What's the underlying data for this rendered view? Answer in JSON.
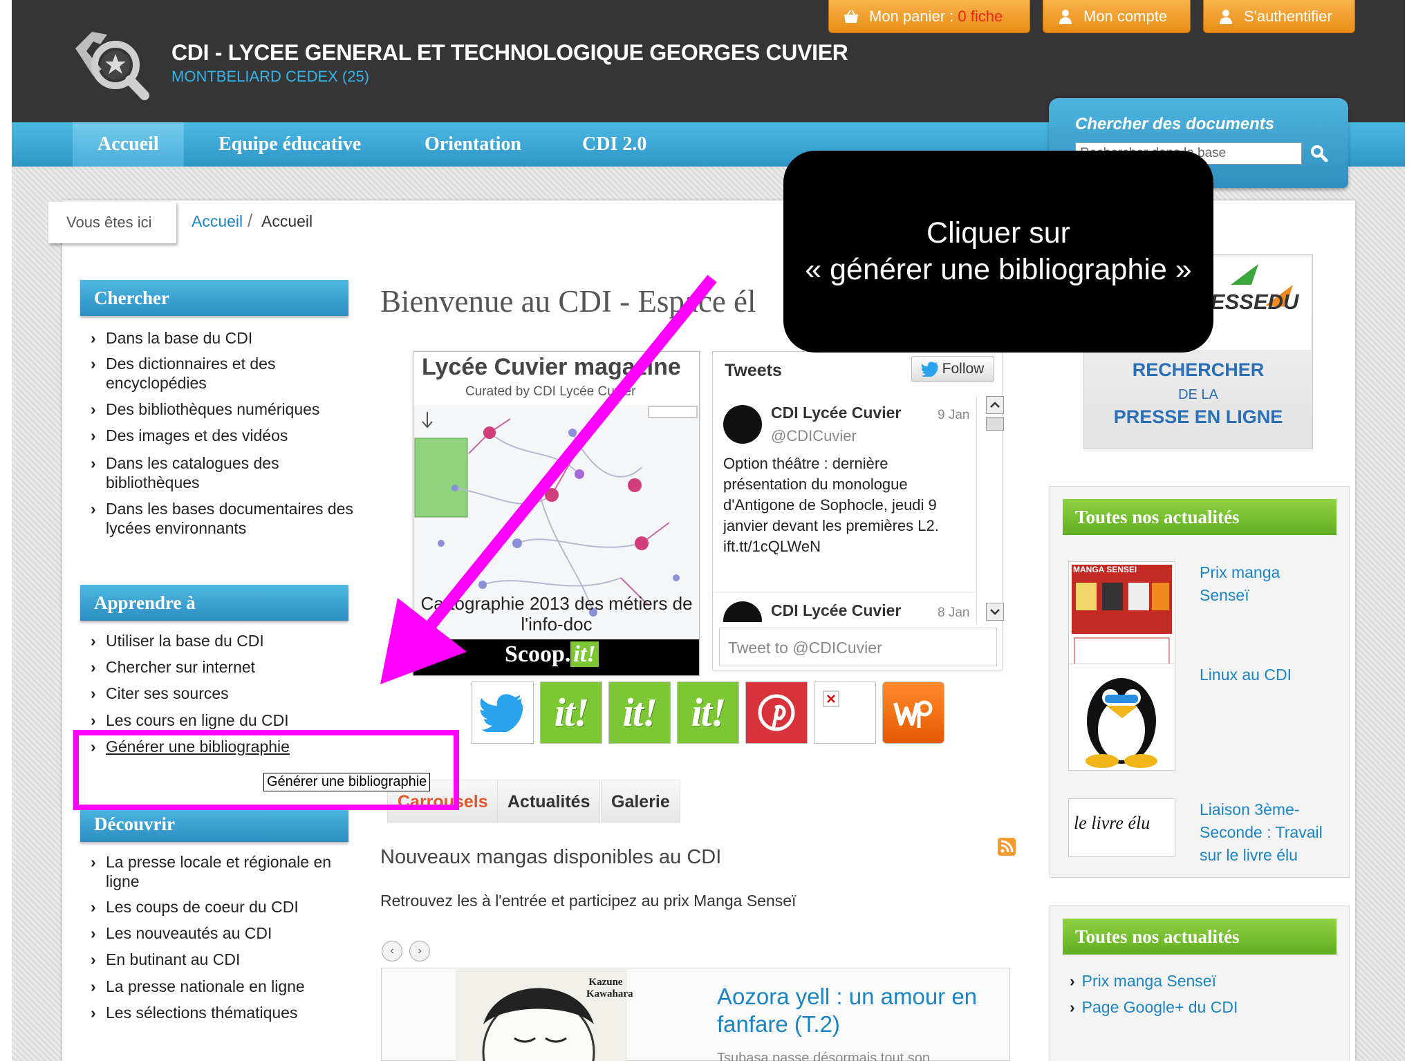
{
  "header": {
    "title": "CDI - LYCEE GENERAL ET TECHNOLOGIQUE GEORGES CUVIER",
    "subtitle": "MONTBELIARD CEDEX (25)",
    "basket_label": "Mon panier : ",
    "basket_count": "0 fiche",
    "account_label": "Mon compte",
    "login_label": "S'authentifier"
  },
  "nav": {
    "items": [
      "Accueil",
      "Equipe éducative",
      "Orientation",
      "CDI 2.0"
    ]
  },
  "search": {
    "title": "Chercher des documents",
    "placeholder": "Rechercher dans la base"
  },
  "breadcrumb": {
    "label": "Vous êtes ici",
    "link": "Accueil",
    "separator": "/",
    "current": "Accueil"
  },
  "sidebar": {
    "chercher": {
      "title": "Chercher",
      "items": [
        "Dans la base du CDI",
        "Des dictionnaires et des encyclopédies",
        "Des bibliothèques numériques",
        "Des images et des vidéos",
        "Dans les catalogues des bibliothèques",
        "Dans les bases documentaires des lycées environnants"
      ]
    },
    "apprendre": {
      "title": "Apprendre à",
      "items": [
        "Utiliser la base du CDI",
        "Chercher sur internet",
        "Citer ses sources",
        "Les cours en ligne du CDI",
        "Générer une bibliographie"
      ]
    },
    "decouvrir": {
      "title": "Découvrir",
      "items": [
        "La presse locale et régionale en ligne",
        "Les coups de coeur du CDI",
        "Les nouveautés au CDI",
        "En butinant au CDI",
        "La presse nationale en ligne",
        "Les sélections thématiques"
      ]
    }
  },
  "tooltip": "Générer une bibliographie",
  "callout": {
    "line1": "Cliquer sur",
    "line2": "« générer une bibliographie »"
  },
  "main": {
    "welcome": "Bienvenue au CDI - Espace él",
    "magazine": {
      "title": "Lycée Cuvier magazine",
      "curated": "Curated by CDI Lycée Cuvier",
      "caption": "Cartographie 2013 des métiers de l'info-doc",
      "brand": "Scoop.",
      "brand_it": "it!"
    },
    "tweets": {
      "title": "Tweets",
      "follow": "Follow",
      "input_placeholder": "Tweet to @CDICuvier",
      "items": [
        {
          "name": "CDI Lycée Cuvier",
          "handle": "@CDICuvier",
          "date": "9 Jan",
          "text": "Option théâtre : dernière présentation du monologue d'Antigone de Sophocle, jeudi 9 janvier devant les premières L2. ift.tt/1cQLWeN"
        },
        {
          "name": "CDI Lycée Cuvier",
          "date": "8 Jan"
        }
      ]
    },
    "social_it": "it!",
    "tabs": [
      "Carrousels",
      "Actualités",
      "Galerie"
    ],
    "news_title": "Nouveaux mangas disponibles au CDI",
    "news_desc": "Retrouvez les à l'entrée et participez au prix Manga Senseï",
    "carousel": {
      "title": "Aozora yell : un amour en fanfare (T.2)",
      "sub": "Tsubasa passe désormais tout son",
      "cover_author": "Kazune Kawahara"
    }
  },
  "right": {
    "presse": {
      "line1": "RECHERCHER",
      "line2": "DE LA",
      "line3": "PRESSE EN LIGNE",
      "logo_text": "COM ESSEDU"
    },
    "news1": {
      "title": "Toutes nos actualités",
      "items": [
        "Prix manga Senseï",
        "Linux au CDI",
        "Liaison 3ème-Seconde : Travail sur le livre élu"
      ],
      "thumb_text_manga": "MANGA SENSEI",
      "thumb_text_livre": "le livre élu"
    },
    "news2": {
      "title": "Toutes nos actualités",
      "items": [
        "Prix manga Senseï",
        "Page Google+ du CDI"
      ]
    }
  },
  "colors": {
    "accent_blue": "#35b3e8",
    "orange": "#f0a030",
    "green": "#7bc834",
    "highlight": "#ff00ff"
  }
}
